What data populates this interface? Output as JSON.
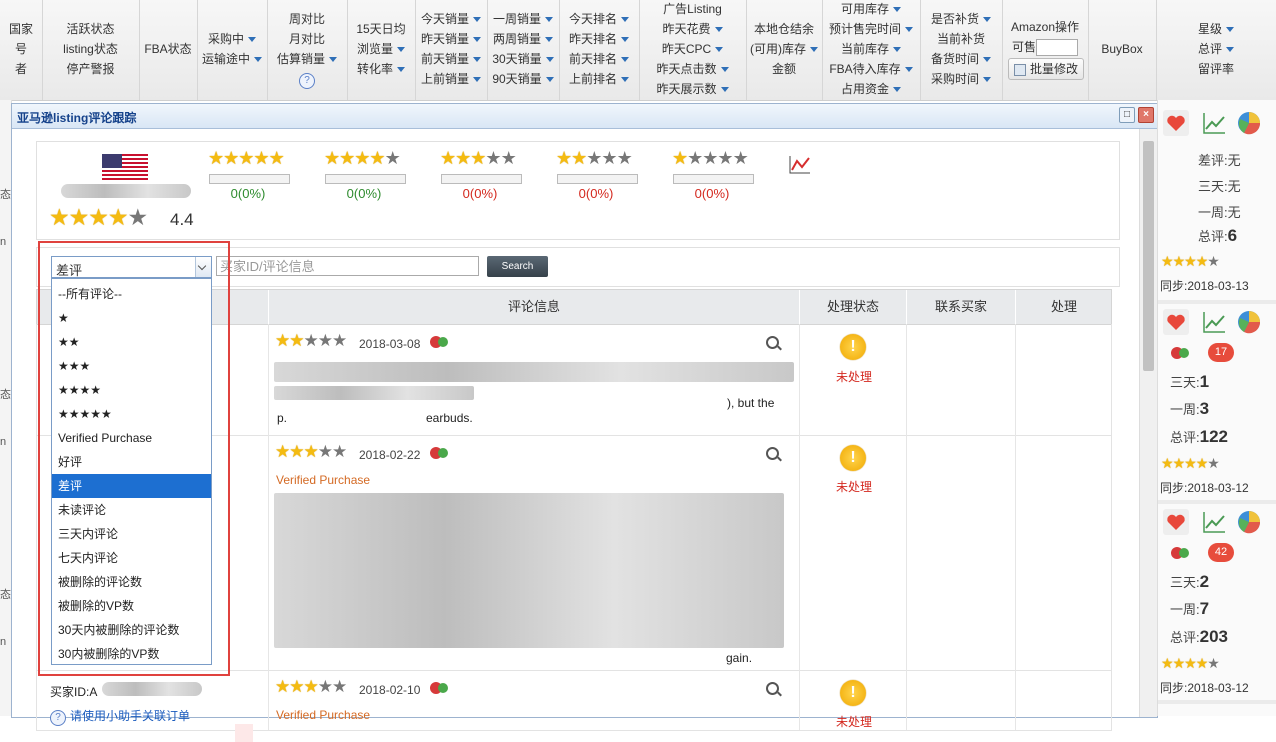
{
  "header": {
    "col0": [
      "国家",
      "号",
      "者"
    ],
    "col1": [
      "活跃状态",
      "listing状态",
      "停产警报"
    ],
    "col2": "FBA状态",
    "col3": [
      "采购中",
      "运输途中"
    ],
    "col4": [
      "周对比",
      "月对比",
      "估算销量"
    ],
    "col5": [
      "15天日均",
      "浏览量",
      "转化率"
    ],
    "col6": [
      "今天销量",
      "昨天销量",
      "前天销量",
      "上前销量"
    ],
    "col7": [
      "一周销量",
      "两周销量",
      "30天销量",
      "90天销量"
    ],
    "col8": [
      "今天排名",
      "昨天排名",
      "前天排名",
      "上前排名"
    ],
    "col9": [
      "广告Listing",
      "昨天花费",
      "昨天CPC",
      "昨天点击数",
      "昨天展示数"
    ],
    "col10": [
      "本地仓结余",
      "(可用)库存",
      "金额"
    ],
    "col11": [
      "可用库存",
      "预计售完时间",
      "当前库存",
      "FBA待入库存",
      "占用资金"
    ],
    "col12": [
      "是否补货",
      "当前补货",
      "备货时间",
      "采购时间"
    ],
    "col13": {
      "line1": "Amazon操作",
      "line2": "可售",
      "button": "批量修改"
    },
    "col14": "BuyBox",
    "col15": [
      "星级",
      "总评",
      "留评率"
    ],
    "qmark": "?"
  },
  "left_stub": [
    "态:",
    "n",
    "态:",
    "n",
    "态:",
    "n"
  ],
  "dialog": {
    "title": "亚马逊listing评论跟踪",
    "rating": "4.4",
    "rating_stars": 4.4,
    "breakdown": [
      {
        "stars": 5,
        "pct_text": "0(0%)",
        "color": "#2e8b2e",
        "fill": 0
      },
      {
        "stars": 4,
        "pct_text": "0(0%)",
        "color": "#2e8b2e",
        "fill": 0
      },
      {
        "stars": 3,
        "pct_text": "0(0%)",
        "color": "#d4291f",
        "fill": 0
      },
      {
        "stars": 2,
        "pct_text": "0(0%)",
        "color": "#d4291f",
        "fill": 0
      },
      {
        "stars": 1,
        "pct_text": "0(0%)",
        "color": "#d4291f",
        "fill": 0
      }
    ],
    "filter": {
      "selected": "差评",
      "search_placeholder": "买家ID/评论信息",
      "search_button": "Search",
      "options": [
        "--所有评论--",
        "★",
        "★★",
        "★★★",
        "★★★★",
        "★★★★★",
        "Verified Purchase",
        "好评",
        "差评",
        "未读评论",
        "三天内评论",
        "七天内评论",
        "被删除的评论数",
        "被删除的VP数",
        "30天内被删除的评论数",
        "30内被删除的VP数"
      ],
      "selected_index": 8
    },
    "table": {
      "headers": [
        "评论信息",
        "处理状态",
        "联系买家",
        "处理"
      ],
      "rows": [
        {
          "stars": 2,
          "date": "2018-03-08",
          "vp": "",
          "status": "未处理",
          "text1": "), but the",
          "text2": "p.",
          "text3": "earbuds."
        },
        {
          "stars": 3,
          "date": "2018-02-22",
          "vp": "Verified Purchase",
          "status": "未处理",
          "text1": "",
          "text2": "",
          "text3": "gain."
        },
        {
          "stars": 3,
          "date": "2018-02-10",
          "vp": "Verified Purchase",
          "status": "未处理",
          "buyer": "买家ID:A",
          "link": "请使用小助手关联订单"
        }
      ]
    }
  },
  "sidebar": {
    "groups": [
      {
        "bad": "差评:无",
        "three": "三天:无",
        "week": "一周:无",
        "total_label": "总评:",
        "total": "6",
        "sync": "同步:2018-03-13",
        "badge": ""
      },
      {
        "three_label": "三天:",
        "three": "1",
        "week_label": "一周:",
        "week": "3",
        "total_label": "总评:",
        "total": "122",
        "sync": "同步:2018-03-12",
        "badge": "17"
      },
      {
        "three_label": "三天:",
        "three": "2",
        "week_label": "一周:",
        "week": "7",
        "total_label": "总评:",
        "total": "203",
        "sync": "同步:2018-03-12",
        "badge": "42"
      }
    ]
  },
  "colors": {
    "accent": "#2f6fb7",
    "highlight": "#1d6fd1",
    "red_frame": "#e0423e",
    "pending": "#d4291f",
    "star": "#f4bb11"
  }
}
